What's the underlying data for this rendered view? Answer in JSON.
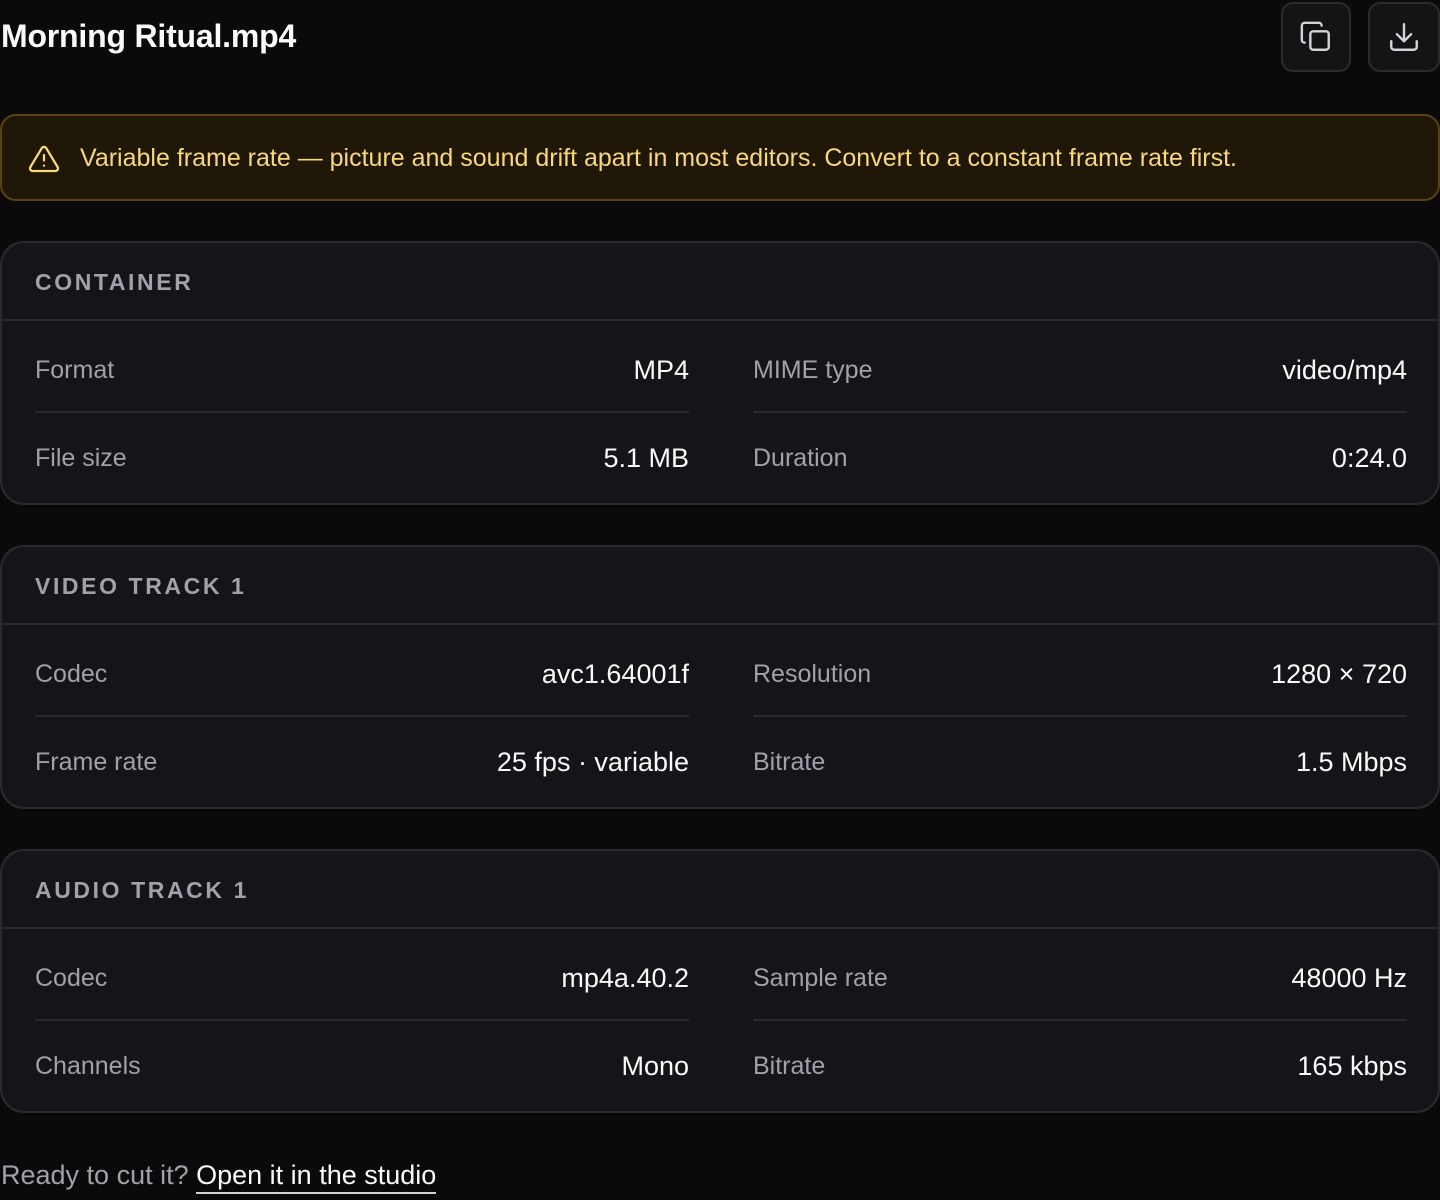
{
  "header": {
    "title": "Morning Ritual.mp4",
    "copy_icon": "copy-icon",
    "download_icon": "download-icon"
  },
  "alert": {
    "icon": "warning-triangle-icon",
    "text": "Variable frame rate — picture and sound drift apart in most editors. Convert to a constant frame rate first.",
    "color": "#f9d77c"
  },
  "sections": [
    {
      "title": "CONTAINER",
      "rows": [
        [
          {
            "label": "Format",
            "value": "MP4"
          },
          {
            "label": "MIME type",
            "value": "video/mp4"
          }
        ],
        [
          {
            "label": "File size",
            "value": "5.1 MB"
          },
          {
            "label": "Duration",
            "value": "0:24.0"
          }
        ]
      ]
    },
    {
      "title": "VIDEO TRACK 1",
      "rows": [
        [
          {
            "label": "Codec",
            "value": "avc1.64001f"
          },
          {
            "label": "Resolution",
            "value": "1280 × 720"
          }
        ],
        [
          {
            "label": "Frame rate",
            "value": "25 fps · variable"
          },
          {
            "label": "Bitrate",
            "value": "1.5 Mbps"
          }
        ]
      ]
    },
    {
      "title": "AUDIO TRACK 1",
      "rows": [
        [
          {
            "label": "Codec",
            "value": "mp4a.40.2"
          },
          {
            "label": "Sample rate",
            "value": "48000 Hz"
          }
        ],
        [
          {
            "label": "Channels",
            "value": "Mono"
          },
          {
            "label": "Bitrate",
            "value": "165 kbps"
          }
        ]
      ]
    }
  ],
  "footer": {
    "prompt": "Ready to cut it?",
    "link": "Open it in the studio"
  }
}
